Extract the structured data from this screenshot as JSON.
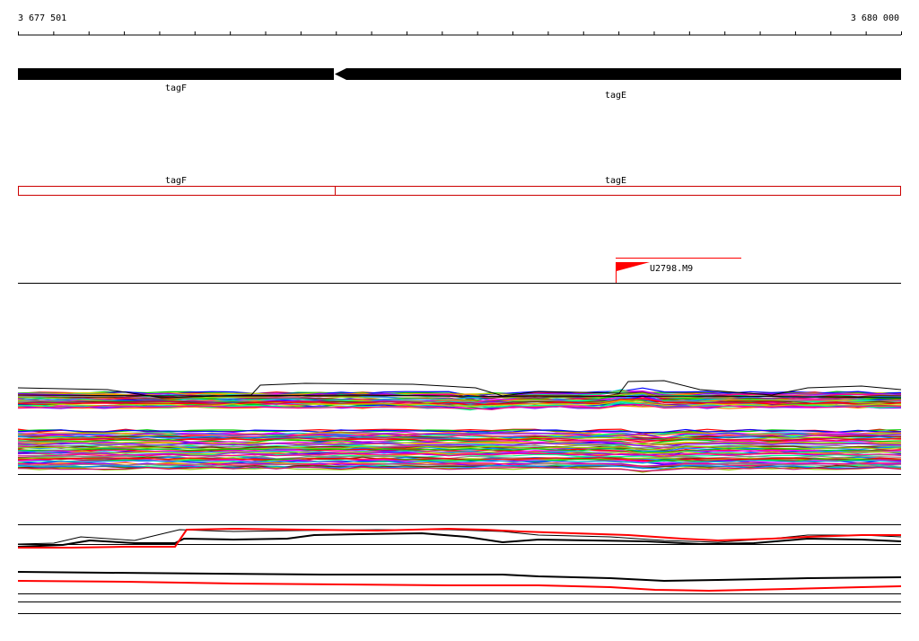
{
  "ruler": {
    "start_label": "3 677 501",
    "end_label": "3 680 000",
    "start": 3677501,
    "end": 3680000
  },
  "genes": [
    {
      "name": "tagF",
      "start": 3677501,
      "end": 3678400,
      "strand": "-"
    },
    {
      "name": "tagE",
      "start": 3678400,
      "end": 3680000,
      "strand": "-"
    }
  ],
  "gene_track_labels": {
    "gene1": "tagF",
    "gene2": "tagE"
  },
  "operon_labels": {
    "gene1": "tagF",
    "gene2": "tagE"
  },
  "promoter": {
    "label": "U2798.M9",
    "position": 3679195,
    "direction": "right"
  },
  "colors": {
    "gene_arrow": "#000000",
    "operon_box": "#cc0000",
    "promoter": "#ff0000",
    "profile_red": "#ff0000",
    "profile_black": "#000000"
  },
  "profile_palette": [
    "#ff0000",
    "#00cc00",
    "#0000ff",
    "#ff00ff",
    "#00cccc",
    "#cccc00",
    "#ff8800",
    "#8800ff",
    "#00ff88",
    "#ff0088",
    "#888888",
    "#663300",
    "#0088ff",
    "#99cc00",
    "#cc0066"
  ]
}
